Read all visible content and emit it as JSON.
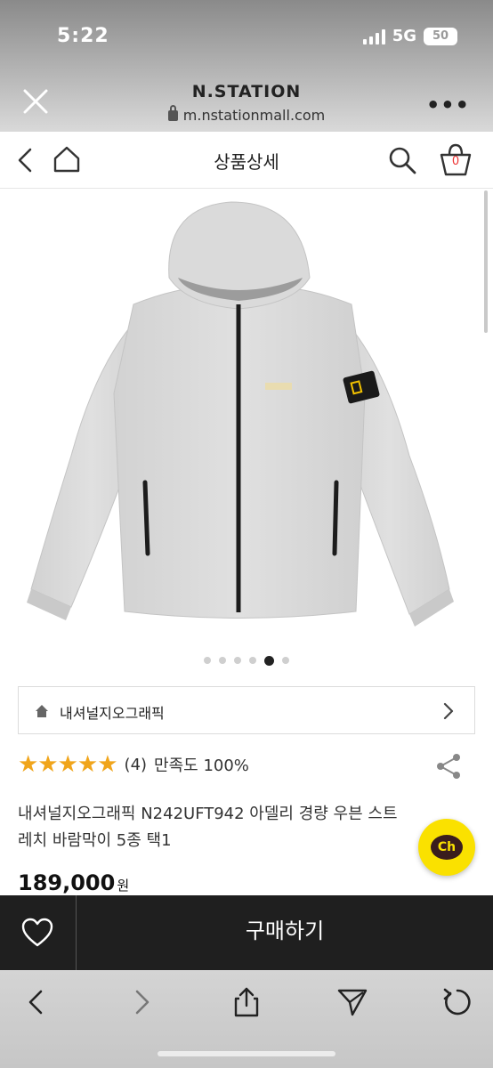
{
  "status_bar": {
    "time": "5:22",
    "network": "5G",
    "battery": "50"
  },
  "browser": {
    "site_title": "N.STATION",
    "url": "m.nstationmall.com",
    "close_icon": "close-icon",
    "more_label": "•••"
  },
  "header": {
    "title": "상품상세",
    "cart_count": "0"
  },
  "gallery": {
    "image_description": "light grey hooded windbreaker",
    "total_dots": 6,
    "active_dot": 5
  },
  "brand": {
    "name": "내셔널지오그래픽"
  },
  "rating": {
    "stars": "★★★★★",
    "count": "(4)",
    "satisfaction": "만족도 100%"
  },
  "product": {
    "name": "내셔널지오그래픽 N242UFT942 아델리 경량 우븐 스트레치 바람막이 5종 택1",
    "price": "189,000",
    "currency": "원"
  },
  "chat": {
    "label": "Ch"
  },
  "buy_bar": {
    "buy_label": "구매하기"
  },
  "colors": {
    "accent_star": "#f0a51c",
    "buy_bar": "#1f1f1f",
    "kakao": "#fae100"
  }
}
